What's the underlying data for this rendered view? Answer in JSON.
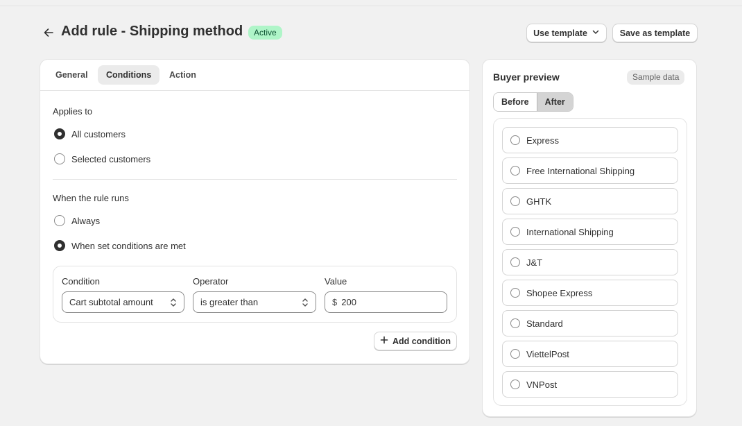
{
  "header": {
    "title": "Add rule - Shipping method",
    "status": "Active",
    "use_template_label": "Use template",
    "save_template_label": "Save as template"
  },
  "tabs": [
    {
      "label": "General"
    },
    {
      "label": "Conditions"
    },
    {
      "label": "Action"
    }
  ],
  "applies_to": {
    "label": "Applies to",
    "options": [
      {
        "label": "All customers",
        "checked": true
      },
      {
        "label": "Selected customers",
        "checked": false
      }
    ]
  },
  "rule_runs": {
    "label": "When the rule runs",
    "options": [
      {
        "label": "Always",
        "checked": false
      },
      {
        "label": "When set conditions are met",
        "checked": true
      }
    ]
  },
  "condition": {
    "condition_label": "Condition",
    "operator_label": "Operator",
    "value_label": "Value",
    "condition_value": "Cart subtotal amount",
    "operator_value": "is greater than",
    "currency": "$",
    "amount": "200",
    "add_label": "Add condition"
  },
  "preview": {
    "title": "Buyer preview",
    "badge": "Sample data",
    "before_label": "Before",
    "after_label": "After",
    "options": [
      {
        "label": "Express"
      },
      {
        "label": "Free International Shipping"
      },
      {
        "label": "GHTK"
      },
      {
        "label": "International Shipping"
      },
      {
        "label": "J&T"
      },
      {
        "label": "Shopee Express"
      },
      {
        "label": "Standard"
      },
      {
        "label": "ViettelPost"
      },
      {
        "label": "VNPost"
      }
    ]
  },
  "colors": {
    "active_badge_bg": "#aff5c8",
    "active_badge_text": "#0c5132",
    "page_bg": "#f1f1f1"
  }
}
